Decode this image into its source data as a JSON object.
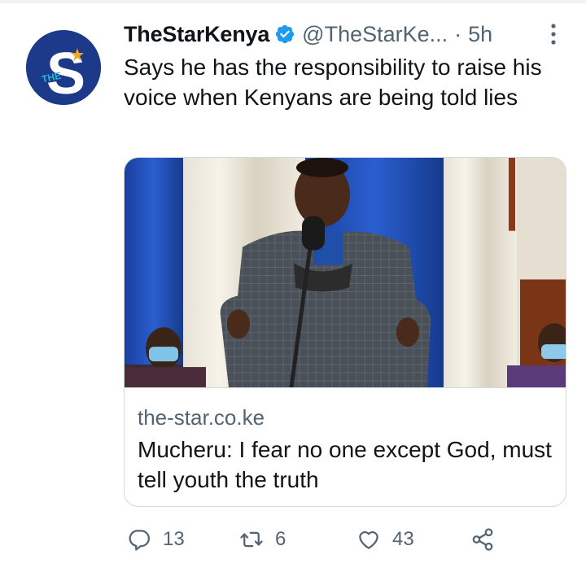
{
  "tweet": {
    "display_name": "TheStarKenya",
    "handle": "@TheStarKe...",
    "separator": "·",
    "time": "5h",
    "text": "Says he has the responsibility to raise his voice when Kenyans are being told lies",
    "avatar": {
      "letter": "S",
      "small_text": "THE"
    }
  },
  "card": {
    "domain": "the-star.co.ke",
    "title": "Mucheru: I fear no one except God, must tell youth the truth"
  },
  "actions": {
    "reply_count": "13",
    "retweet_count": "6",
    "like_count": "43"
  },
  "icons": {
    "verified": "verified-badge-icon",
    "more": "more-vertical-icon",
    "reply": "reply-icon",
    "retweet": "retweet-icon",
    "like": "heart-icon",
    "share": "share-icon"
  },
  "colors": {
    "text_primary": "#0f1419",
    "text_secondary": "#536471",
    "verified_blue": "#1d9bf0",
    "avatar_bg": "#1d3a8a",
    "avatar_accent": "#29b6d6",
    "avatar_star": "#f5a623",
    "border": "#cfd9de"
  }
}
